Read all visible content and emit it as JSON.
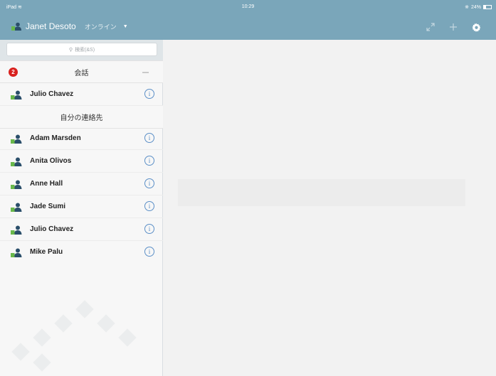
{
  "status_bar": {
    "device": "iPad",
    "time": "10:29",
    "battery": "24%"
  },
  "header": {
    "user_name": "Janet Desoto",
    "presence": "オンライン",
    "icons": [
      "expand-icon",
      "plus-icon",
      "gear-icon"
    ]
  },
  "sidebar": {
    "search_placeholder": "検索(&S)",
    "conversations": {
      "label": "会話",
      "badge_count": "2"
    },
    "conversation_items": [
      {
        "name": "Julio Chavez"
      }
    ],
    "contacts_section_label": "自分の連絡先",
    "contacts": [
      {
        "name": "Adam Marsden"
      },
      {
        "name": "Anita Olivos"
      },
      {
        "name": "Anne Hall"
      },
      {
        "name": "Jade Sumi"
      },
      {
        "name": "Julio Chavez"
      },
      {
        "name": "Mike Palu"
      }
    ]
  },
  "colors": {
    "header_bg": "#7aa6ba",
    "badge": "#d9211e",
    "info_icon": "#5b8fc7"
  }
}
